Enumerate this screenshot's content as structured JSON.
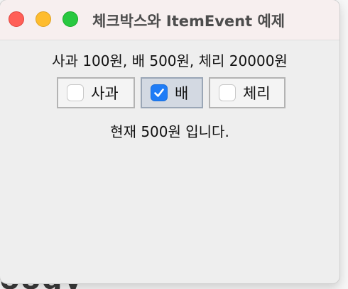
{
  "window": {
    "title": "체크박스와 ItemEvent 예제",
    "controls": [
      "close",
      "minimize",
      "zoom"
    ]
  },
  "info_text": "사과 100원, 배 500원, 체리 20000원",
  "checkboxes": [
    {
      "label": "사과",
      "checked": false
    },
    {
      "label": "배",
      "checked": true
    },
    {
      "label": "체리",
      "checked": false
    }
  ],
  "status_text": "현재 500원 입니다.",
  "background_text": "oogy",
  "colors": {
    "accent": "#1f7cf6",
    "close": "#ff5f57",
    "minimize": "#febc2e",
    "zoom": "#28c840",
    "titlebar": "#f7efef",
    "panel": "#eeeeee"
  }
}
